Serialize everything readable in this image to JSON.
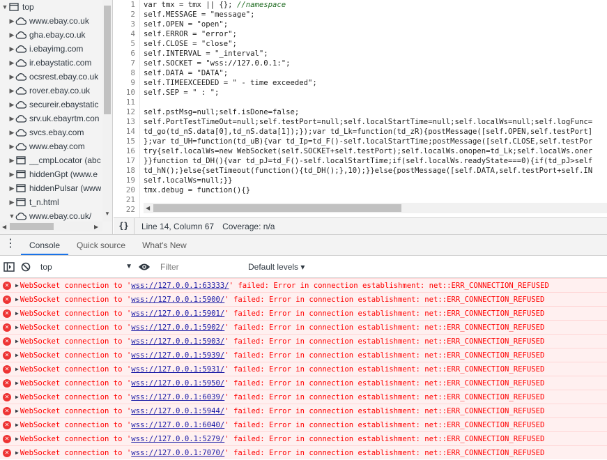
{
  "sidebar": {
    "items": [
      {
        "label": "top",
        "arrow": "▼",
        "icon": "frame"
      },
      {
        "label": "www.ebay.co.uk",
        "arrow": "▶",
        "icon": "cloud"
      },
      {
        "label": "gha.ebay.co.uk",
        "arrow": "▶",
        "icon": "cloud"
      },
      {
        "label": "i.ebayimg.com",
        "arrow": "▶",
        "icon": "cloud"
      },
      {
        "label": "ir.ebaystatic.com",
        "arrow": "▶",
        "icon": "cloud"
      },
      {
        "label": "ocsrest.ebay.co.uk",
        "arrow": "▶",
        "icon": "cloud"
      },
      {
        "label": "rover.ebay.co.uk",
        "arrow": "▶",
        "icon": "cloud"
      },
      {
        "label": "secureir.ebaystatic",
        "arrow": "▶",
        "icon": "cloud"
      },
      {
        "label": "srv.uk.ebayrtm.con",
        "arrow": "▶",
        "icon": "cloud"
      },
      {
        "label": "svcs.ebay.com",
        "arrow": "▶",
        "icon": "cloud"
      },
      {
        "label": "www.ebay.com",
        "arrow": "▶",
        "icon": "cloud"
      },
      {
        "label": "__cmpLocator (abc",
        "arrow": "▶",
        "icon": "frame"
      },
      {
        "label": "hiddenGpt (www.e",
        "arrow": "▶",
        "icon": "frame"
      },
      {
        "label": "hiddenPulsar (www",
        "arrow": "▶",
        "icon": "frame"
      },
      {
        "label": "t_n.html",
        "arrow": "▶",
        "icon": "frame"
      },
      {
        "label": "www.ebay.co.uk/",
        "arrow": "▼",
        "icon": "cloud"
      }
    ]
  },
  "editor": {
    "line_numbers": [
      "1",
      "2",
      "3",
      "4",
      "5",
      "6",
      "7",
      "8",
      "9",
      "10",
      "11",
      "12",
      "13",
      "14",
      "15",
      "16",
      "17",
      "18",
      "19",
      "20",
      "21",
      "22"
    ],
    "lines": [
      {
        "text": "var tmx = tmx || {}; ",
        "comment": "//namespace"
      },
      {
        "text": "self.MESSAGE = \"message\";"
      },
      {
        "text": "self.OPEN = \"open\";"
      },
      {
        "text": "self.ERROR = \"error\";"
      },
      {
        "text": "self.CLOSE = \"close\";"
      },
      {
        "text": "self.INTERVAL = \"_interval\";"
      },
      {
        "text": "self.SOCKET = \"wss://127.0.0.1:\";"
      },
      {
        "text": "self.DATA = \"DATA\";"
      },
      {
        "text": "self.TIMEEXCEEDED = \" - time exceeded\";"
      },
      {
        "text": "self.SEP = \" : \";"
      },
      {
        "text": ""
      },
      {
        "text": "self.pstMsg=null;self.isDone=false;"
      },
      {
        "text": "self.PortTestTimeOut=null;self.testPort=null;self.localStartTime=null;self.localWs=null;self.logFunc="
      },
      {
        "text": "td_go(td_nS.data[0],td_nS.data[1]);});var td_Lk=function(td_zR){postMessage([self.OPEN,self.testPort]"
      },
      {
        "text": "};var td_UH=function(td_uB){var td_Ip=td_F()-self.localStartTime;postMessage([self.CLOSE,self.testPor"
      },
      {
        "text": "try{self.localWs=new WebSocket(self.SOCKET+self.testPort);self.localWs.onopen=td_Lk;self.localWs.oner"
      },
      {
        "text": "}}function td_DH(){var td_pJ=td_F()-self.localStartTime;if(self.localWs.readyState===0){if(td_pJ>self"
      },
      {
        "text": "td_hN();}else{setTimeout(function(){td_DH();},10);}}else{postMessage([self.DATA,self.testPort+self.IN"
      },
      {
        "text": "self.localWs=null;}}"
      },
      {
        "text": "tmx.debug = function(){}"
      },
      {
        "text": ""
      },
      {
        "text": ""
      }
    ]
  },
  "statusbar": {
    "pretty_print": "{}",
    "cursor": "Line 14, Column 67",
    "coverage": "Coverage: n/a"
  },
  "drawer": {
    "menu": "⋮",
    "tabs": [
      {
        "label": "Console",
        "active": true
      },
      {
        "label": "Quick source",
        "active": false
      },
      {
        "label": "What's New",
        "active": false
      }
    ]
  },
  "console_toolbar": {
    "context": "top",
    "filter_placeholder": "Filter",
    "levels": "Default levels ▾"
  },
  "messages": [
    {
      "prefix": "WebSocket connection to '",
      "url": "wss://127.0.0.1:63333/",
      "suffix": "' failed: Error in connection establishment: net::ERR_CONNECTION_REFUSED"
    },
    {
      "prefix": "WebSocket connection to '",
      "url": "wss://127.0.0.1:5900/",
      "suffix": "' failed: Error in connection establishment: net::ERR_CONNECTION_REFUSED"
    },
    {
      "prefix": "WebSocket connection to '",
      "url": "wss://127.0.0.1:5901/",
      "suffix": "' failed: Error in connection establishment: net::ERR_CONNECTION_REFUSED"
    },
    {
      "prefix": "WebSocket connection to '",
      "url": "wss://127.0.0.1:5902/",
      "suffix": "' failed: Error in connection establishment: net::ERR_CONNECTION_REFUSED"
    },
    {
      "prefix": "WebSocket connection to '",
      "url": "wss://127.0.0.1:5903/",
      "suffix": "' failed: Error in connection establishment: net::ERR_CONNECTION_REFUSED"
    },
    {
      "prefix": "WebSocket connection to '",
      "url": "wss://127.0.0.1:5939/",
      "suffix": "' failed: Error in connection establishment: net::ERR_CONNECTION_REFUSED"
    },
    {
      "prefix": "WebSocket connection to '",
      "url": "wss://127.0.0.1:5931/",
      "suffix": "' failed: Error in connection establishment: net::ERR_CONNECTION_REFUSED"
    },
    {
      "prefix": "WebSocket connection to '",
      "url": "wss://127.0.0.1:5950/",
      "suffix": "' failed: Error in connection establishment: net::ERR_CONNECTION_REFUSED"
    },
    {
      "prefix": "WebSocket connection to '",
      "url": "wss://127.0.0.1:6039/",
      "suffix": "' failed: Error in connection establishment: net::ERR_CONNECTION_REFUSED"
    },
    {
      "prefix": "WebSocket connection to '",
      "url": "wss://127.0.0.1:5944/",
      "suffix": "' failed: Error in connection establishment: net::ERR_CONNECTION_REFUSED"
    },
    {
      "prefix": "WebSocket connection to '",
      "url": "wss://127.0.0.1:6040/",
      "suffix": "' failed: Error in connection establishment: net::ERR_CONNECTION_REFUSED"
    },
    {
      "prefix": "WebSocket connection to '",
      "url": "wss://127.0.0.1:5279/",
      "suffix": "' failed: Error in connection establishment: net::ERR_CONNECTION_REFUSED"
    },
    {
      "prefix": "WebSocket connection to '",
      "url": "wss://127.0.0.1:7070/",
      "suffix": "' failed: Error in connection establishment: net::ERR_CONNECTION_REFUSED"
    }
  ],
  "colors": {
    "error_text": "#ff0000",
    "error_bg": "#fff0f0",
    "link": "#1a1aa6",
    "accent": "#1a73e8",
    "comment": "#236e25"
  }
}
